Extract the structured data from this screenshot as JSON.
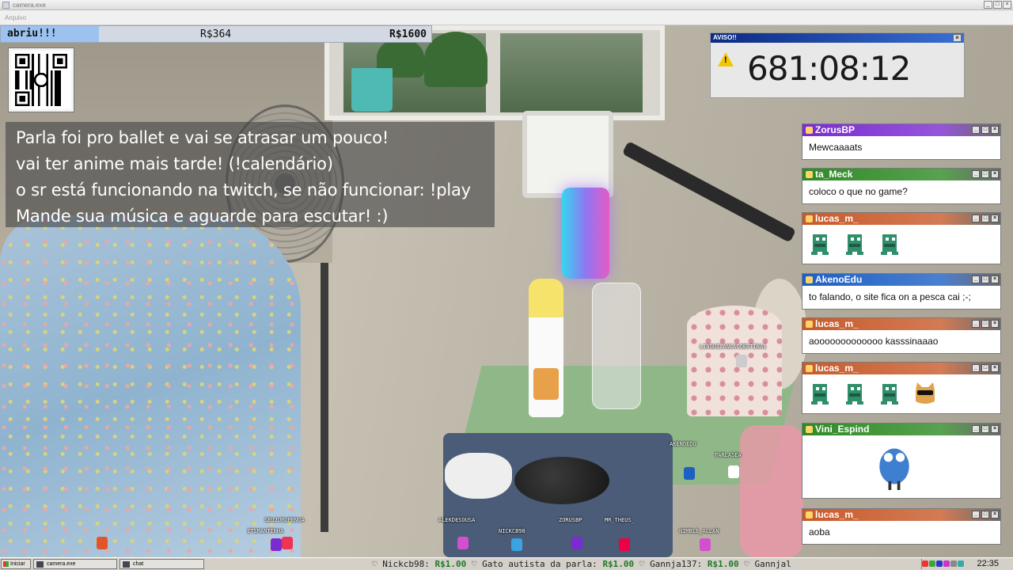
{
  "window": {
    "title": "camera.exe",
    "menu_item": "Arquivo",
    "controls": [
      "_",
      "□",
      "×"
    ]
  },
  "goal": {
    "label": "abriu!!!",
    "current": "R$364",
    "target": "R$1600",
    "progress_fraction": 0.2275
  },
  "qr": {
    "icon": "qr-code-icon"
  },
  "announcement": {
    "lines": [
      "Parla foi pro ballet e vai se atrasar um pouco!",
      "vai ter anime mais tarde! (!calendário)",
      "o sr está funcionando na twitch, se não funcionar: !play",
      "Mande sua música e aguarde para escutar! :)"
    ]
  },
  "aviso": {
    "title": "AVISO!!",
    "close": "×",
    "timer": "681:08:12",
    "icon": "warning-icon",
    "warn_glyph": "!"
  },
  "chat_controls": [
    "_",
    "□",
    "×"
  ],
  "chat": [
    {
      "user": "ZorusBP",
      "color": "#7b2bd1",
      "text": "Mewcaaaats",
      "emotes": 0
    },
    {
      "user": "ta_Meck",
      "color": "#2e8a24",
      "text": "coloco o que no game?",
      "emotes": 0
    },
    {
      "user": "lucas_m_",
      "color": "#c85a2a",
      "text": "",
      "emotes": 3
    },
    {
      "user": "AkenoEdu",
      "color": "#1d5fc4",
      "text": "to falando, o site fica on a pesca cai ;-;",
      "emotes": 0
    },
    {
      "user": "lucas_m_",
      "color": "#c85a2a",
      "text": "aooooooooooooo kasssinaaao",
      "emotes": 0
    },
    {
      "user": "lucas_m_",
      "color": "#c85a2a",
      "text": "",
      "emotes": 4
    },
    {
      "user": "Vini_Espind",
      "color": "#2e8a24",
      "text": "",
      "emotes": 1
    },
    {
      "user": "lucas_m_",
      "color": "#c85a2a",
      "text": "aoba",
      "emotes": 0
    }
  ],
  "chatters": [
    {
      "name": "LINGUICANCACOESTINA1",
      "color": "#cccccc"
    },
    {
      "name": "AKENOEDU",
      "color": "#1d5fc4"
    },
    {
      "name": "PARLASEA",
      "color": "#ffffff"
    },
    {
      "name": "SEUJURUPENGA",
      "color": "#7b2bd1"
    },
    {
      "name": "ITSMANTINHA",
      "color": "#e35"
    },
    {
      "name": "ALEKDESOUSA",
      "color": "#d24fd0"
    },
    {
      "name": "NICKCB98",
      "color": "#3aa3e0"
    },
    {
      "name": "ZORUSBP",
      "color": "#7b2bd1"
    },
    {
      "name": "MR_THEUS_",
      "color": "#e04"
    },
    {
      "name": "NIMBLE_ALLAN",
      "color": "#d24fd0"
    }
  ],
  "taskbar": {
    "start": "Iniciar",
    "tasks": [
      "camera.exe",
      "chat"
    ],
    "ticker": [
      {
        "name": "Nickcb98:",
        "amount": "R$1.00"
      },
      {
        "name": "Gato autista da parla:",
        "amount": "R$1.00"
      },
      {
        "name": "Gannja137:",
        "amount": "R$1.00"
      },
      {
        "name": "Gannjal",
        "amount": ""
      }
    ],
    "separator": "♡",
    "clock": "22:35",
    "tray_colors": [
      "#e33",
      "#3a3",
      "#33c",
      "#c3c",
      "#888",
      "#3aa"
    ]
  }
}
